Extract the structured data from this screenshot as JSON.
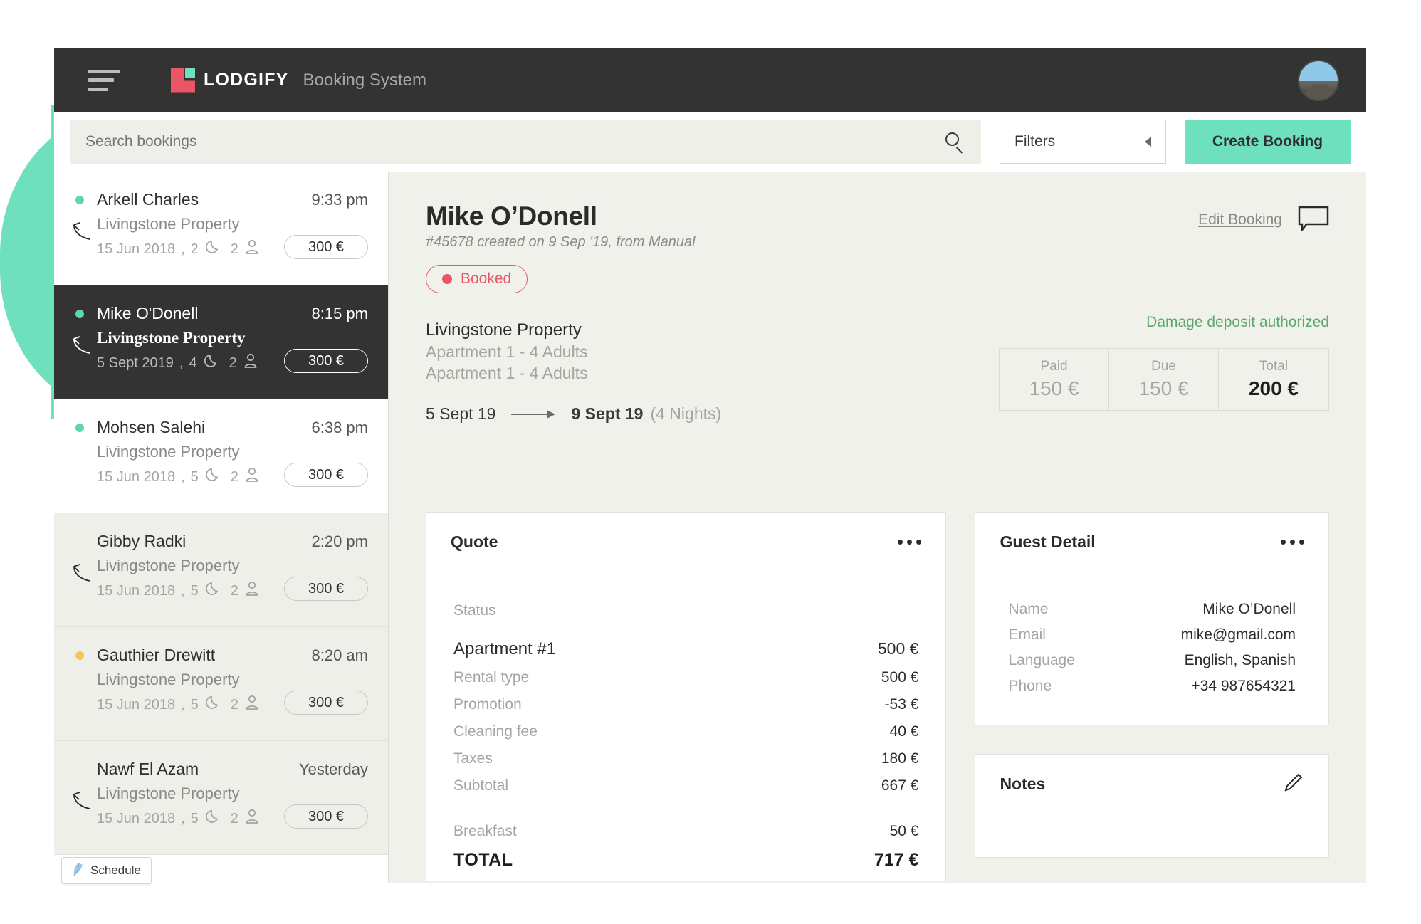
{
  "header": {
    "brand": "LODGIFY",
    "subtitle": "Booking System",
    "menu_icon": "hamburger-icon",
    "avatar_icon": "user-avatar"
  },
  "search": {
    "placeholder": "Search bookings",
    "value": "",
    "icon": "search-icon",
    "filters_label": "Filters",
    "create_label": "Create Booking"
  },
  "bookings": [
    {
      "name": "Arkell Charles",
      "time": "9:33 pm",
      "property": "Livingstone Property",
      "date": "15 Jun 2018",
      "nights": "2",
      "guests": "2",
      "price": "300 €",
      "dot": "teal",
      "replied": true,
      "state": "unread"
    },
    {
      "name": "Mike O'Donell",
      "time": "8:15 pm",
      "property": "Livingstone Property",
      "date": "5 Sept 2019",
      "nights": "4",
      "guests": "2",
      "price": "300 €",
      "dot": "teal",
      "replied": true,
      "state": "active"
    },
    {
      "name": "Mohsen Salehi",
      "time": "6:38 pm",
      "property": "Livingstone Property",
      "date": "15 Jun 2018",
      "nights": "5",
      "guests": "2",
      "price": "300 €",
      "dot": "teal",
      "replied": false,
      "state": "unread"
    },
    {
      "name": "Gibby Radki",
      "time": "2:20 pm",
      "property": "Livingstone Property",
      "date": "15 Jun 2018",
      "nights": "5",
      "guests": "2",
      "price": "300 €",
      "dot": "none",
      "replied": true,
      "state": "read"
    },
    {
      "name": "Gauthier Drewitt",
      "time": "8:20 am",
      "property": "Livingstone Property",
      "date": "15 Jun 2018",
      "nights": "5",
      "guests": "2",
      "price": "300 €",
      "dot": "yellow",
      "replied": false,
      "state": "read"
    },
    {
      "name": "Nawf El Azam",
      "time": "Yesterday",
      "property": "Livingstone Property",
      "date": "15 Jun 2018",
      "nights": "5",
      "guests": "2",
      "price": "300 €",
      "dot": "none",
      "replied": true,
      "state": "read"
    }
  ],
  "detail": {
    "guest_name": "Mike O’Donell",
    "meta": "#45678 created on 9 Sep '19, from Manual",
    "status": "Booked",
    "edit_label": "Edit Booking",
    "property": "Livingstone Property",
    "unit_line_1": "Apartment 1 - 4 Adults",
    "unit_line_2": "Apartment 1 - 4 Adults",
    "check_in": "5 Sept 19",
    "check_out": "9 Sept 19",
    "nights_label": "(4 Nights)",
    "deposit_note": "Damage deposit authorized",
    "payments": [
      {
        "label": "Paid",
        "value": "150 €"
      },
      {
        "label": "Due",
        "value": "150 €"
      },
      {
        "label": "Total",
        "value": "200 €"
      }
    ]
  },
  "quote": {
    "title": "Quote",
    "status_label": "Status",
    "rows": [
      {
        "label": "Apartment #1",
        "value": "500 €",
        "style": "major"
      },
      {
        "label": "Rental type",
        "value": "500 €",
        "style": "sub"
      },
      {
        "label": "Promotion",
        "value": "-53 €",
        "style": "sub"
      },
      {
        "label": "Cleaning fee",
        "value": "40 €",
        "style": "sub"
      },
      {
        "label": "Taxes",
        "value": "180 €",
        "style": "sub"
      },
      {
        "label": "Subtotal",
        "value": "667 €",
        "style": "sub"
      },
      {
        "label": "Breakfast",
        "value": "50 €",
        "style": "sub"
      }
    ],
    "total_label": "TOTAL",
    "total_value": "717 €"
  },
  "guest_detail": {
    "title": "Guest Detail",
    "rows": [
      {
        "label": "Name",
        "value": "Mike O’Donell"
      },
      {
        "label": "Email",
        "value": "mike@gmail.com"
      },
      {
        "label": "Language",
        "value": "English, Spanish"
      },
      {
        "label": "Phone",
        "value": "+34 987654321"
      }
    ]
  },
  "notes": {
    "title": "Notes",
    "edit_icon": "pencil-icon"
  },
  "schedule_badge": {
    "label": "Schedule",
    "icon": "feather-icon"
  },
  "colors": {
    "accent_teal": "#6FE0BE",
    "brand_red": "#EC5565",
    "status_red": "#EC5565",
    "status_green": "#5CA86E",
    "status_yellow": "#F2C94C",
    "dark_bar": "#333333",
    "page_bg": "#F1F1EC"
  }
}
